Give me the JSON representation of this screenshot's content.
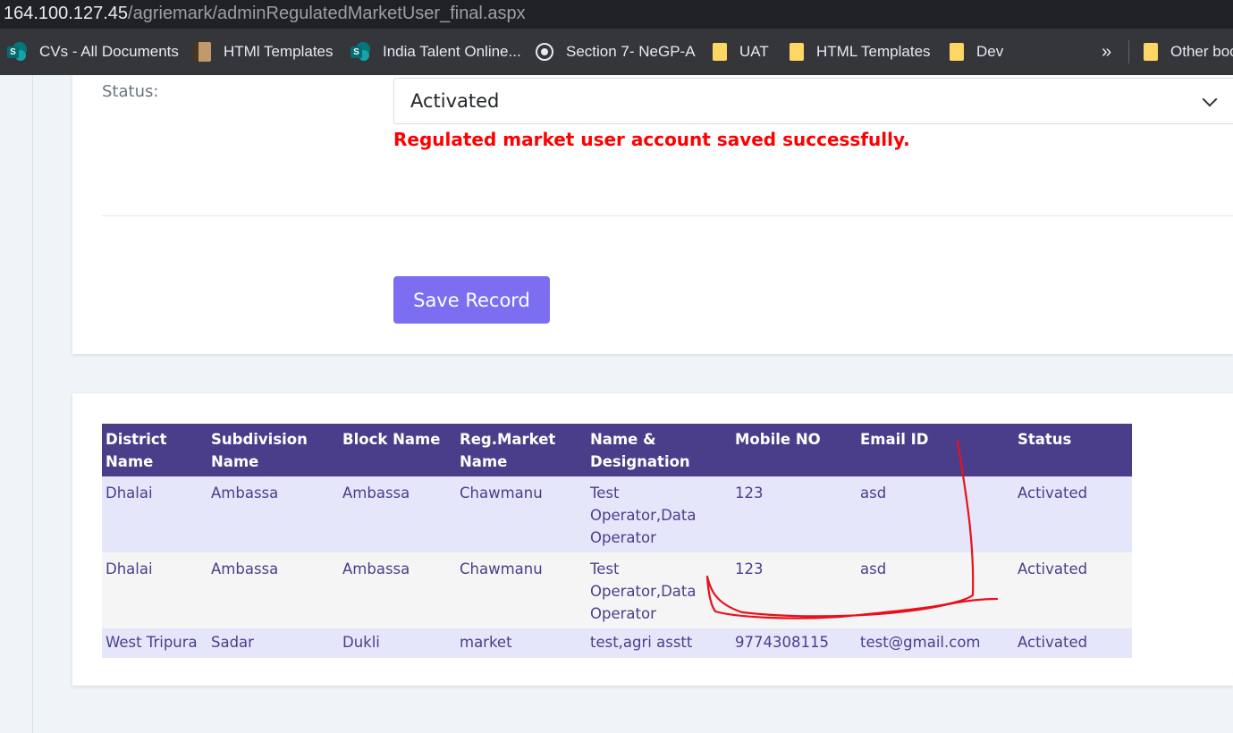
{
  "browser": {
    "url_host": "164.100.127.45",
    "url_path": "/agriemark/adminRegulatedMarketUser_final.aspx",
    "bookmarks": [
      {
        "label": "CVs - All Documents",
        "icon": "sharepoint-icon"
      },
      {
        "label": "HTMl Templates",
        "icon": "template-icon"
      },
      {
        "label": "India Talent Online...",
        "icon": "sharepoint-icon"
      },
      {
        "label": "Section 7- NeGP-A",
        "icon": "globe-icon"
      },
      {
        "label": "UAT",
        "icon": "folder-icon"
      },
      {
        "label": "HTML Templates",
        "icon": "folder-icon"
      },
      {
        "label": "Dev",
        "icon": "folder-icon"
      }
    ],
    "more_label": "»",
    "other_bookmarks": "Other bookmarks"
  },
  "form": {
    "status_label": "Status:",
    "status_value": "Activated",
    "success_message": "Regulated market user account saved successfully.",
    "save_label": "Save Record"
  },
  "table": {
    "headers": [
      "District Name",
      "Subdivision Name",
      "Block Name",
      "Reg.Market Name",
      "Name & Designation",
      "Mobile NO",
      "Email ID",
      "Status"
    ],
    "rows": [
      [
        "Dhalai",
        "Ambassa",
        "Ambassa",
        "Chawmanu",
        "Test Operator,Data Operator",
        "123",
        "asd",
        "Activated"
      ],
      [
        "Dhalai",
        "Ambassa",
        "Ambassa",
        "Chawmanu",
        "Test Operator,Data Operator",
        "123",
        "asd",
        "Activated"
      ],
      [
        "West Tripura",
        "Sadar",
        "Dukli",
        "market",
        "test,agri asstt",
        "9774308115",
        "test@gmail.com",
        "Activated"
      ]
    ]
  },
  "colors": {
    "accent": "#7b6ef0",
    "table_header": "#4a3e8a",
    "error": "#ff0000",
    "annotation": "#e8101a"
  }
}
